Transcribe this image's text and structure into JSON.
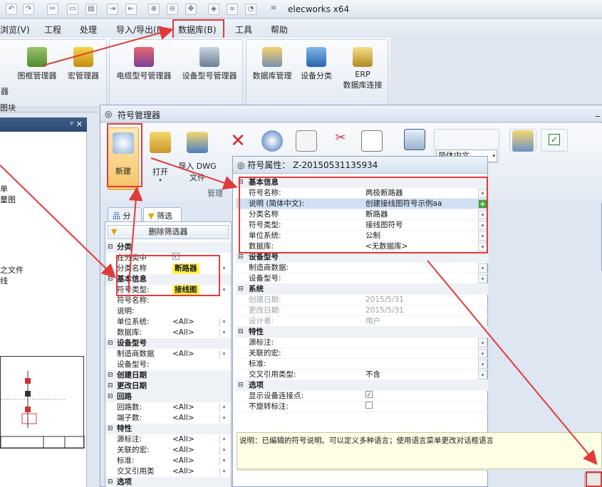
{
  "app": {
    "title": "elecworks x64"
  },
  "menubar": {
    "items": [
      "浏览(V)",
      "工程",
      "处理",
      "导入/导出(I)",
      "数据库(B)",
      "工具",
      "帮助"
    ]
  },
  "ribbon": {
    "left_partial": "器",
    "group_left_label": "图块",
    "btn_frame": "图框管理器",
    "btn_macro": "宏管理器",
    "btn_cable": "电缆型号管理器",
    "btn_device": "设备型号管理器",
    "btn_dbmgr": "数据库管理",
    "btn_class": "设备分类",
    "btn_erp_1": "ERP",
    "btn_erp_2": "数据库连接"
  },
  "left_panel": {
    "pin": "ᵖ ✕",
    "items": [
      "单",
      "量图",
      "之文件",
      "线"
    ]
  },
  "symbol_manager": {
    "title": "符号管理器",
    "close": "_",
    "toolbar": {
      "new": "新建",
      "open": "打开",
      "import": "导入 DWG",
      "import2": "文件",
      "group_label": "管理",
      "lang": "简体中文"
    },
    "tabs": {
      "classify": "分类",
      "filter": "筛选"
    },
    "delete_filter": "删除筛选器",
    "filter_rows": [
      {
        "kind": "sect",
        "label": "分类"
      },
      {
        "kind": "check",
        "label": "在分类中",
        "checked": "✓"
      },
      {
        "kind": "field",
        "label": "分类名称",
        "value": "断路器"
      },
      {
        "kind": "sect",
        "label": "基本信息"
      },
      {
        "kind": "field",
        "label": "符号类型:",
        "value": "接线图"
      },
      {
        "kind": "field",
        "label": "符号名称:",
        "value": ""
      },
      {
        "kind": "field",
        "label": "说明:",
        "value": ""
      },
      {
        "kind": "field",
        "label": "单位系统:",
        "value": "<All>"
      },
      {
        "kind": "field",
        "label": "数据库:",
        "value": "<All>"
      },
      {
        "kind": "sect",
        "label": "设备型号"
      },
      {
        "kind": "field",
        "label": "制造商数据",
        "value": "<All>"
      },
      {
        "kind": "field",
        "label": "设备型号:",
        "value": ""
      },
      {
        "kind": "sect",
        "label": "创建日期"
      },
      {
        "kind": "sect",
        "label": "更改日期"
      },
      {
        "kind": "sect",
        "label": "回路"
      },
      {
        "kind": "field",
        "label": "回路数:",
        "value": "<All>"
      },
      {
        "kind": "field",
        "label": "端子数:",
        "value": "<All>"
      },
      {
        "kind": "sect",
        "label": "特性"
      },
      {
        "kind": "field",
        "label": "源标注:",
        "value": "<All>"
      },
      {
        "kind": "field",
        "label": "关联的宏:",
        "value": "<All>"
      },
      {
        "kind": "field",
        "label": "标准:",
        "value": "<All>"
      },
      {
        "kind": "field",
        "label": "交叉引用类",
        "value": "<All>"
      },
      {
        "kind": "sect",
        "label": "选项"
      }
    ]
  },
  "properties": {
    "title": "符号属性：  Z-20150531135934",
    "rows": [
      {
        "kind": "sect",
        "label": "基本信息"
      },
      {
        "kind": "field",
        "label": "符号名称:",
        "value": "两极断路器"
      },
      {
        "kind": "field",
        "label": "说明 (简体中文):",
        "value": "创建接线图符号示例aa",
        "hl": true
      },
      {
        "kind": "field",
        "label": "分类名称",
        "value": "断路器"
      },
      {
        "kind": "field",
        "label": "符号类型:",
        "value": "接线图符号"
      },
      {
        "kind": "field",
        "label": "单位系统:",
        "value": "公制"
      },
      {
        "kind": "field",
        "label": "数据库:",
        "value": "<无数据库>"
      },
      {
        "kind": "sect",
        "label": "设备型号"
      },
      {
        "kind": "field",
        "label": "制造商数据:",
        "value": ""
      },
      {
        "kind": "field",
        "label": "设备型号:",
        "value": ""
      },
      {
        "kind": "sect",
        "label": "系统"
      },
      {
        "kind": "field",
        "label": "创建日期:",
        "value": "2015/5/31",
        "grey": true
      },
      {
        "kind": "field",
        "label": "更改日期:",
        "value": "2015/5/31",
        "grey": true
      },
      {
        "kind": "field",
        "label": "设计者:",
        "value": "用户",
        "grey": true
      },
      {
        "kind": "sect",
        "label": "特性"
      },
      {
        "kind": "field",
        "label": "源标注:",
        "value": ""
      },
      {
        "kind": "field",
        "label": "关联的宏:",
        "value": ""
      },
      {
        "kind": "field",
        "label": "标准:",
        "value": ""
      },
      {
        "kind": "field",
        "label": "交叉引用类型:",
        "value": "不含"
      },
      {
        "kind": "sect",
        "label": "选项"
      },
      {
        "kind": "check",
        "label": "显示设备连接点:",
        "checked": "✓"
      },
      {
        "kind": "check",
        "label": "不旋转标注:",
        "checked": ""
      }
    ],
    "description": "说明：已编辑的符号说明。可以定义多种语言；使用语言菜单更改对话框语言"
  },
  "colors": {
    "accent_red": "#e23a3a",
    "selection": "#cfe0f5",
    "yellow": "#fff24a"
  }
}
